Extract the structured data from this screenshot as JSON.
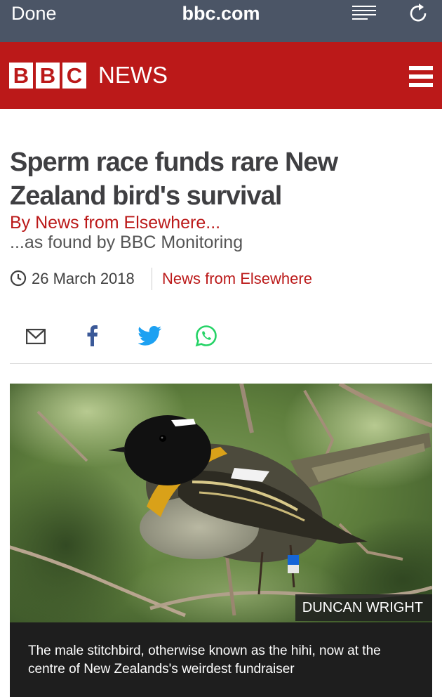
{
  "browser": {
    "done_label": "Done",
    "url": "bbc.com",
    "reader_icon": "reader-mode-icon",
    "reload_icon": "reload-icon"
  },
  "header": {
    "logo_letters": [
      "B",
      "B",
      "C"
    ],
    "logo_word": "NEWS",
    "menu_icon": "hamburger-menu-icon",
    "brand_color": "#bb1919"
  },
  "article": {
    "headline": "Sperm race funds rare New Zealand bird's survival",
    "byline": "By News from Elsewhere...",
    "byline_sub": "...as found by BBC Monitoring",
    "date": "26 March 2018",
    "section": "News from Elsewhere"
  },
  "share": {
    "icons": [
      "email-icon",
      "facebook-icon",
      "twitter-icon",
      "whatsapp-icon"
    ]
  },
  "image": {
    "credit": "DUNCAN WRIGHT",
    "caption": "The male stitchbird, otherwise known as the hihi, now at the centre of New Zealands's weirdest fundraiser"
  }
}
